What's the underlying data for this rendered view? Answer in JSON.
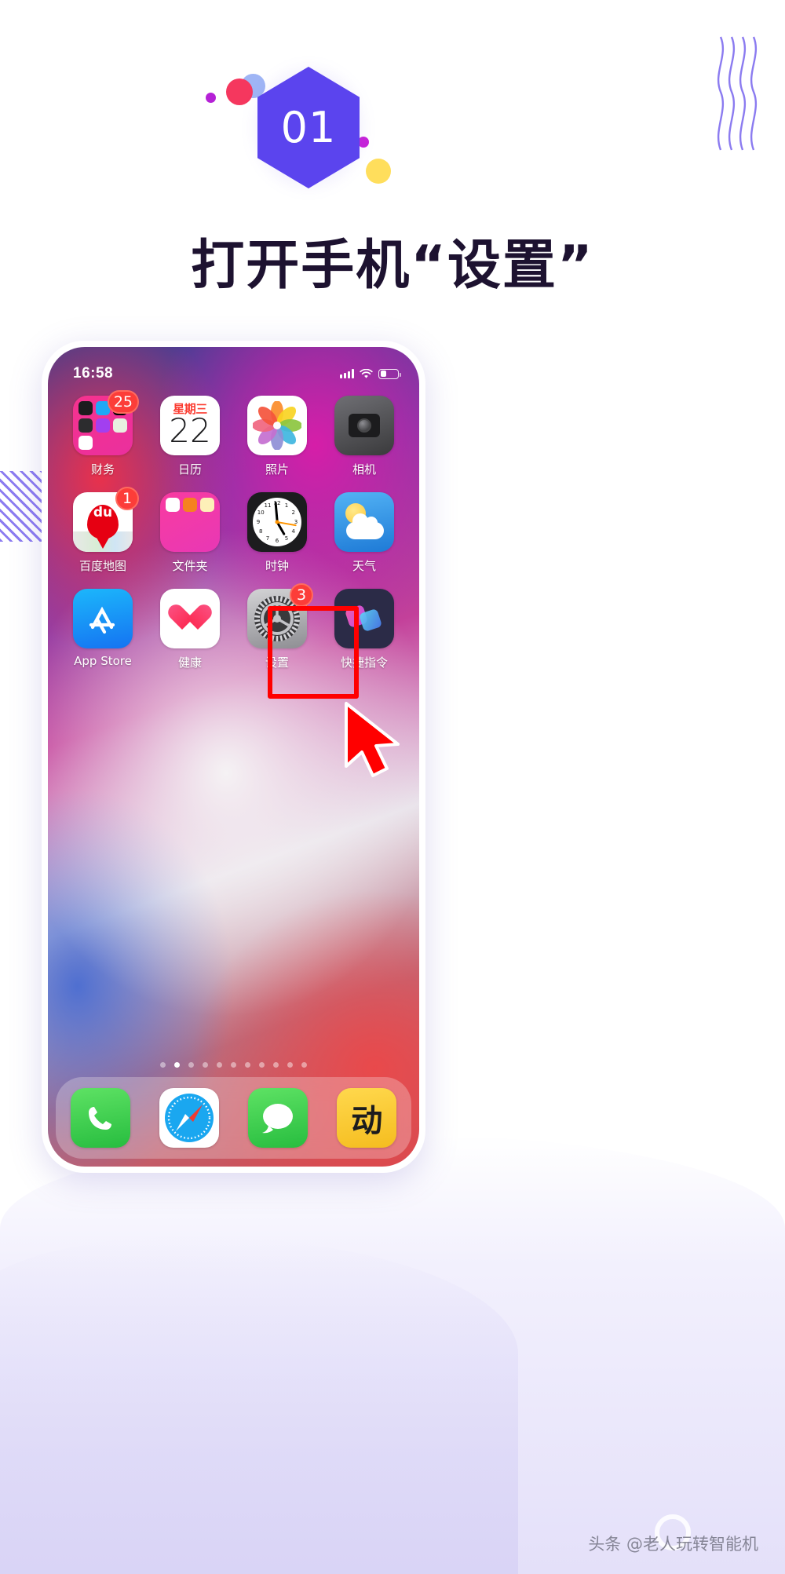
{
  "step": {
    "number": "01",
    "title": "打开手机“设置”"
  },
  "phone": {
    "status_bar": {
      "time": "16:58",
      "signal_icon": "cellular-signal-icon",
      "wifi_icon": "wifi-icon",
      "battery_icon": "battery-icon"
    },
    "home_screen": {
      "rows": [
        [
          {
            "label": "财务",
            "icon": "folder-icon",
            "badge": "25"
          },
          {
            "label": "日历",
            "icon": "calendar-icon",
            "badge": "",
            "calendar_dow": "星期三",
            "calendar_day": "22"
          },
          {
            "label": "照片",
            "icon": "photos-icon",
            "badge": ""
          },
          {
            "label": "相机",
            "icon": "camera-icon",
            "badge": ""
          }
        ],
        [
          {
            "label": "百度地图",
            "icon": "baidu-maps-icon",
            "badge": "1",
            "wordmark": "du"
          },
          {
            "label": "文件夹",
            "icon": "folder-icon",
            "badge": ""
          },
          {
            "label": "时钟",
            "icon": "clock-icon",
            "badge": ""
          },
          {
            "label": "天气",
            "icon": "weather-icon",
            "badge": ""
          }
        ],
        [
          {
            "label": "App Store",
            "icon": "app-store-icon",
            "badge": ""
          },
          {
            "label": "健康",
            "icon": "health-icon",
            "badge": ""
          },
          {
            "label": "设置",
            "icon": "settings-gear-icon",
            "badge": "3",
            "highlighted": true
          },
          {
            "label": "快捷指令",
            "icon": "shortcuts-icon",
            "badge": ""
          }
        ]
      ]
    },
    "page_dots": {
      "count": 11,
      "active_index": 1
    },
    "dock": [
      {
        "label": "电话",
        "icon": "phone-icon"
      },
      {
        "label": "Safari",
        "icon": "safari-compass-icon"
      },
      {
        "label": "信息",
        "icon": "messages-icon"
      },
      {
        "label": "输入法",
        "icon": "ime-icon",
        "glyph": "动"
      }
    ],
    "clock_face_ticks": [
      "12",
      "1",
      "2",
      "3",
      "4",
      "5",
      "6",
      "7",
      "8",
      "9",
      "10",
      "11"
    ]
  },
  "annotation": {
    "highlight_color": "#ff0000",
    "cursor_icon": "mouse-cursor-arrow"
  },
  "watermark": {
    "text": "头条 @老人玩转智能机"
  },
  "colors": {
    "accent_purple": "#5b44ee",
    "badge_red": "#fc3d39",
    "title_dark": "#1d1230",
    "yellow": "#ffde5c",
    "pink_red": "#f5375e"
  }
}
